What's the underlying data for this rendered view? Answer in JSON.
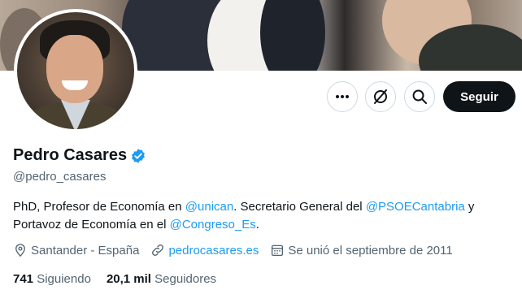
{
  "profile": {
    "name": "Pedro Casares",
    "handle": "@pedro_casares",
    "bio": {
      "p1": "PhD, Profesor de Economía en ",
      "m1": "@unican",
      "p2": ". Secretario General del ",
      "m2": "@PSOECantabria",
      "p3": " y Portavoz de Economía en el ",
      "m3": "@Congreso_Es",
      "p4": "."
    },
    "location": "Santander - España",
    "website": "pedrocasares.es",
    "joined": "Se unió el septiembre de 2011",
    "following_count": "741",
    "following_label": "Siguiendo",
    "followers_count": "20,1 mil",
    "followers_label": "Seguidores"
  },
  "actions": {
    "follow_label": "Seguir",
    "more_icon": "more-icon",
    "subscribe_icon": "subscribe-icon",
    "search_icon": "search-icon"
  },
  "colors": {
    "accent": "#1d9bf0",
    "text": "#0f1419",
    "secondary": "#536471",
    "follow_bg": "#0f1419"
  }
}
